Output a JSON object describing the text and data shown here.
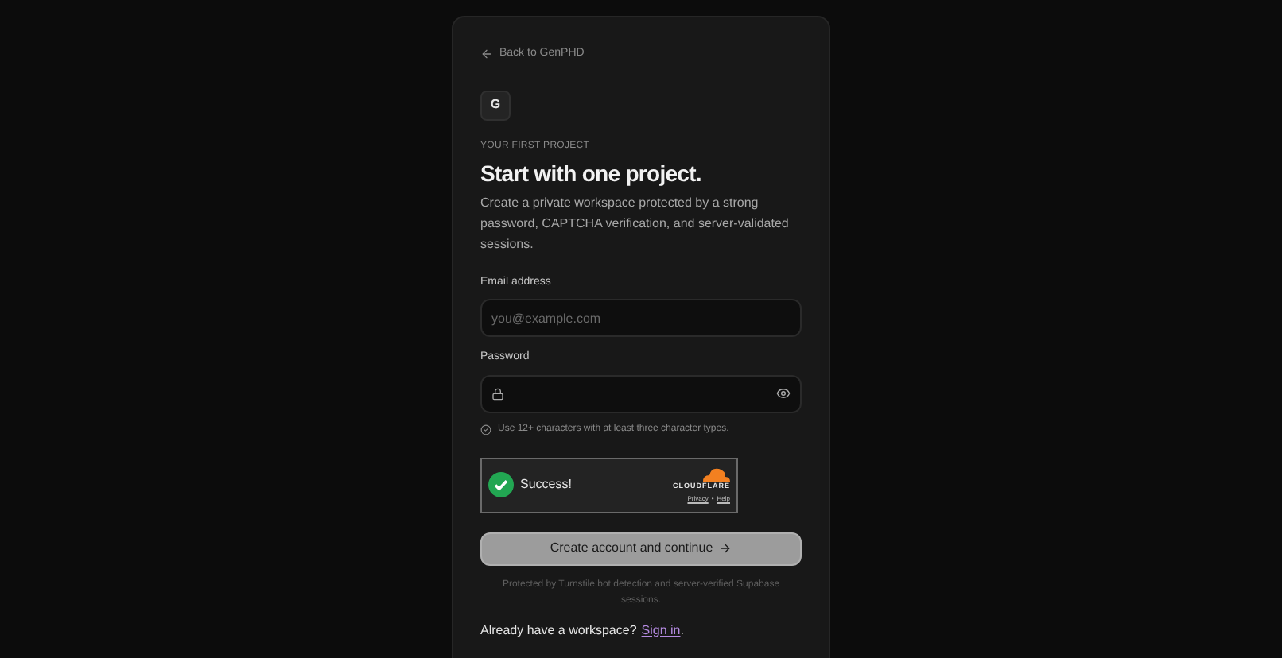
{
  "back_link": "Back to GenPHD",
  "logo": "G",
  "eyebrow": "YOUR FIRST PROJECT",
  "title": "Start with one project.",
  "description": "Create a private workspace protected by a strong password, CAPTCHA verification, and server-validated sessions.",
  "email": {
    "label": "Email address",
    "placeholder": "you@example.com"
  },
  "password": {
    "label": "Password",
    "hint": "Use 12+ characters with at least three character types."
  },
  "captcha": {
    "status": "Success!",
    "brand": "CLOUDFLARE",
    "privacy": "Privacy",
    "separator": "•",
    "help": "Help"
  },
  "submit": "Create account and continue",
  "footnote": "Protected by Turnstile bot detection and server-verified Supabase sessions.",
  "signin": {
    "prompt": "Already have a workspace?",
    "link": "Sign in",
    "end": "."
  }
}
